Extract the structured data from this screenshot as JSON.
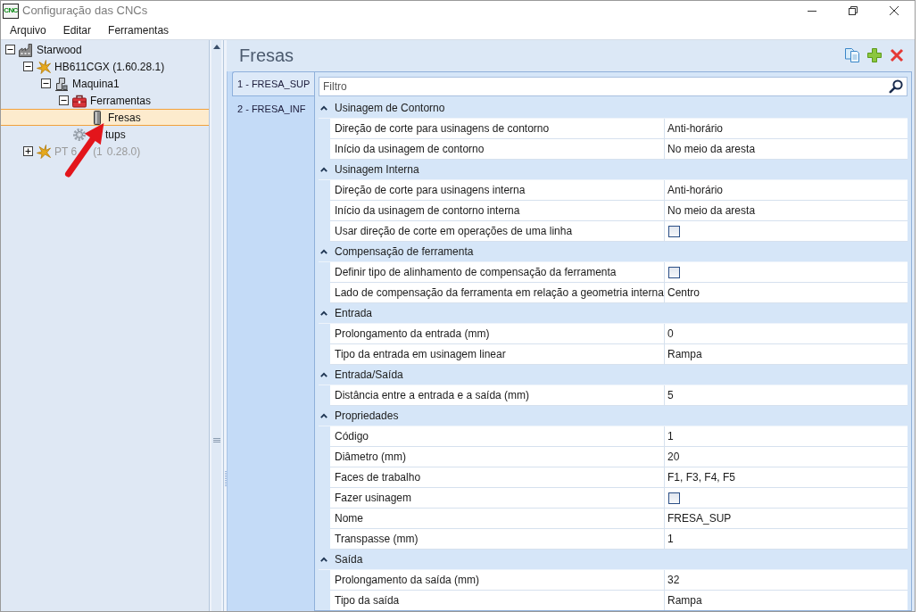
{
  "window": {
    "logo_text": "CNC",
    "title": "Configuração das CNCs"
  },
  "menu": [
    "Arquivo",
    "Editar",
    "Ferramentas"
  ],
  "tree": [
    {
      "label": "Starwood",
      "kind": "site",
      "expanded": true,
      "selected": false,
      "disabled": false,
      "children": [
        {
          "label": "HB611CGX (1.60.28.1)",
          "kind": "cnc",
          "expanded": true,
          "selected": false,
          "disabled": false,
          "children": [
            {
              "label": "Maquina1",
              "kind": "machine",
              "expanded": true,
              "selected": false,
              "disabled": false,
              "children": [
                {
                  "label": "Ferramentas",
                  "kind": "tools",
                  "expanded": true,
                  "selected": false,
                  "disabled": false,
                  "children": [
                    {
                      "label": "Fresas",
                      "kind": "cutter",
                      "selected": true,
                      "disabled": false
                    }
                  ]
                },
                {
                  "visible_parts": [
                    "tups"
                  ],
                  "covered_start": true,
                  "kind": "setups",
                  "selected": false,
                  "disabled": false
                }
              ]
            }
          ]
        },
        {
          "visible_parts": [
            "PT 6",
            "(1",
            "0.28.0)"
          ],
          "kind": "cnc",
          "expanded": false,
          "selected": false,
          "disabled": true
        }
      ]
    }
  ],
  "annotation": {
    "kind": "arrow"
  },
  "panel": {
    "title": "Fresas"
  },
  "tabs": [
    {
      "label": "1 - FRESA_SUP",
      "selected": true
    },
    {
      "label": "2 - FRESA_INF",
      "selected": false
    }
  ],
  "filter": {
    "placeholder": "Filtro"
  },
  "categories": [
    {
      "title": "Usinagem de Contorno",
      "expanded": true,
      "rows": [
        {
          "name": "Direção de corte para usinagens de contorno",
          "kind": "text",
          "value": "Anti-horário"
        },
        {
          "name": "Início da usinagem de contorno",
          "kind": "text",
          "value": "No meio da aresta"
        }
      ]
    },
    {
      "title": "Usinagem Interna",
      "expanded": true,
      "rows": [
        {
          "name": "Direção de corte para usinagens interna",
          "kind": "text",
          "value": "Anti-horário"
        },
        {
          "name": "Início da usinagem de contorno interna",
          "kind": "text",
          "value": "No meio da aresta"
        },
        {
          "name": "Usar direção de corte em operações de uma linha",
          "kind": "checkbox",
          "checked": false
        }
      ]
    },
    {
      "title": "Compensação de ferramenta",
      "expanded": true,
      "rows": [
        {
          "name": "Definir tipo de alinhamento de compensação da ferramenta",
          "kind": "checkbox",
          "checked": false
        },
        {
          "name": "Lado de compensação da ferramenta em relação a geometria interna",
          "kind": "text",
          "value": "Centro"
        }
      ]
    },
    {
      "title": "Entrada",
      "expanded": true,
      "rows": [
        {
          "name": "Prolongamento da entrada (mm)",
          "kind": "text",
          "value": "0"
        },
        {
          "name": "Tipo da entrada em usinagem linear",
          "kind": "text",
          "value": "Rampa"
        }
      ]
    },
    {
      "title": "Entrada/Saída",
      "expanded": true,
      "rows": [
        {
          "name": "Distância entre a entrada e a saída (mm)",
          "kind": "text",
          "value": "5"
        }
      ]
    },
    {
      "title": "Propriedades",
      "expanded": true,
      "rows": [
        {
          "name": "Código",
          "kind": "text",
          "value": "1"
        },
        {
          "name": "Diâmetro (mm)",
          "kind": "text",
          "value": "20"
        },
        {
          "name": "Faces de trabalho",
          "kind": "text",
          "value": "F1, F3, F4, F5"
        },
        {
          "name": "Fazer usinagem",
          "kind": "checkbox",
          "checked": false
        },
        {
          "name": "Nome",
          "kind": "text",
          "value": "FRESA_SUP"
        },
        {
          "name": "Transpasse (mm)",
          "kind": "text",
          "value": "1"
        }
      ]
    },
    {
      "title": "Saída",
      "expanded": true,
      "rows": [
        {
          "name": "Prolongamento da saída (mm)",
          "kind": "text",
          "value": "32"
        },
        {
          "name": "Tipo da saída",
          "kind": "text",
          "value": "Rampa"
        }
      ]
    }
  ]
}
